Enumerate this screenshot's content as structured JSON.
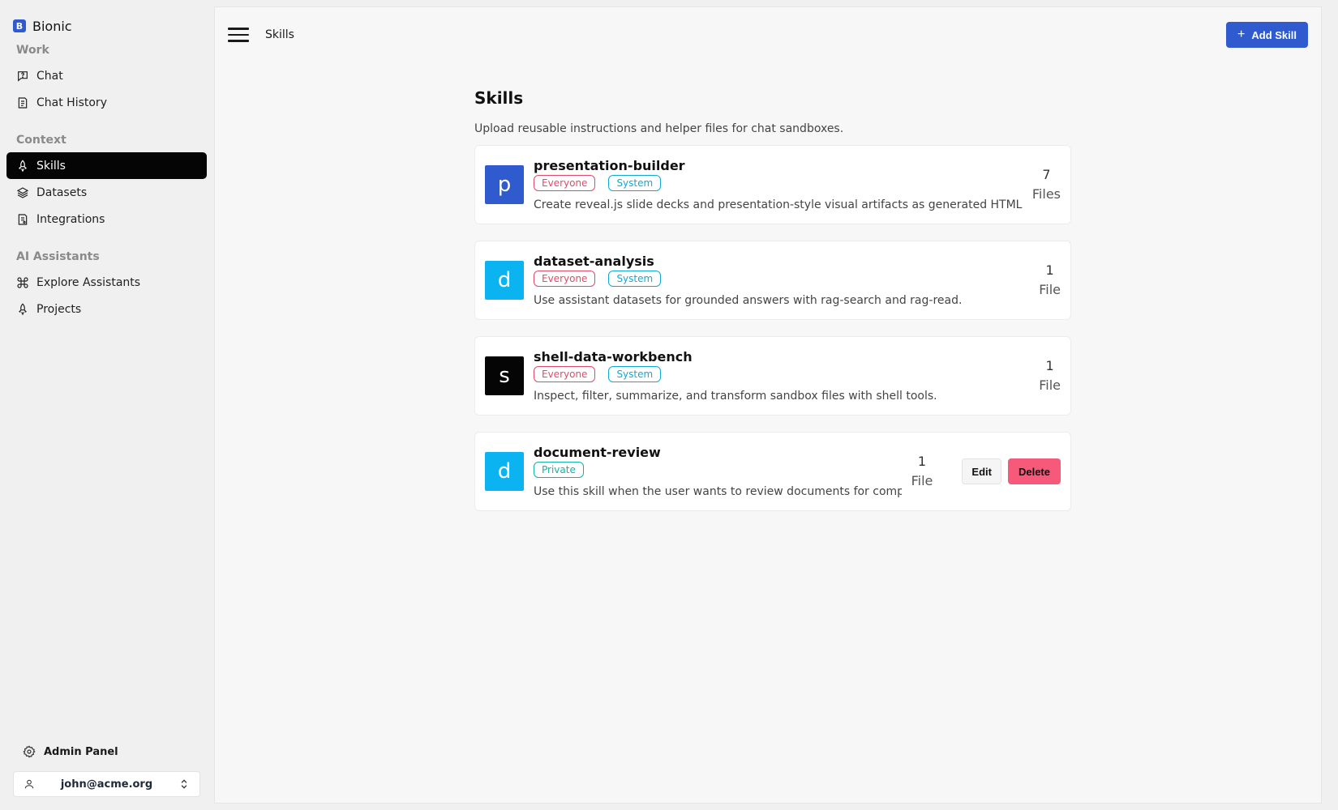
{
  "brand": {
    "logo_letter": "B",
    "name": "Bionic"
  },
  "sidebar": {
    "sections": [
      {
        "title": "Work",
        "items": [
          {
            "label": "Chat",
            "icon": "chat-icon"
          },
          {
            "label": "Chat History",
            "icon": "history-icon"
          }
        ]
      },
      {
        "title": "Context",
        "items": [
          {
            "label": "Skills",
            "icon": "rocket-icon",
            "active": true
          },
          {
            "label": "Datasets",
            "icon": "layers-icon"
          },
          {
            "label": "Integrations",
            "icon": "integrations-icon"
          }
        ]
      },
      {
        "title": "AI Assistants",
        "items": [
          {
            "label": "Explore Assistants",
            "icon": "command-icon"
          },
          {
            "label": "Projects",
            "icon": "rocket-icon"
          }
        ]
      }
    ],
    "admin_label": "Admin Panel",
    "user_email": "john@acme.org"
  },
  "header": {
    "breadcrumb": "Skills",
    "add_button_label": "Add Skill"
  },
  "main": {
    "title": "Skills",
    "subtitle": "Upload reusable instructions and helper files for chat sandboxes.",
    "skills": [
      {
        "letter": "p",
        "avatar_color": "#2f5bcf",
        "name": "presentation-builder",
        "badges": [
          "Everyone",
          "System"
        ],
        "description": "Create reveal.js slide decks and presentation-style visual artifacts as generated HTML canvas",
        "file_count": "7",
        "file_unit": "Files",
        "editable": false
      },
      {
        "letter": "d",
        "avatar_color": "#0bb4f0",
        "name": "dataset-analysis",
        "badges": [
          "Everyone",
          "System"
        ],
        "description": "Use assistant datasets for grounded answers with rag-search and rag-read.",
        "file_count": "1",
        "file_unit": "File",
        "editable": false
      },
      {
        "letter": "s",
        "avatar_color": "#050505",
        "name": "shell-data-workbench",
        "badges": [
          "Everyone",
          "System"
        ],
        "description": "Inspect, filter, summarize, and transform sandbox files with shell tools.",
        "file_count": "1",
        "file_unit": "File",
        "editable": false
      },
      {
        "letter": "d",
        "avatar_color": "#0bb4f0",
        "name": "document-review",
        "badges": [
          "Private"
        ],
        "description": "Use this skill when the user wants to review documents for completeness",
        "file_count": "1",
        "file_unit": "File",
        "editable": true,
        "edit_label": "Edit",
        "delete_label": "Delete"
      }
    ]
  }
}
